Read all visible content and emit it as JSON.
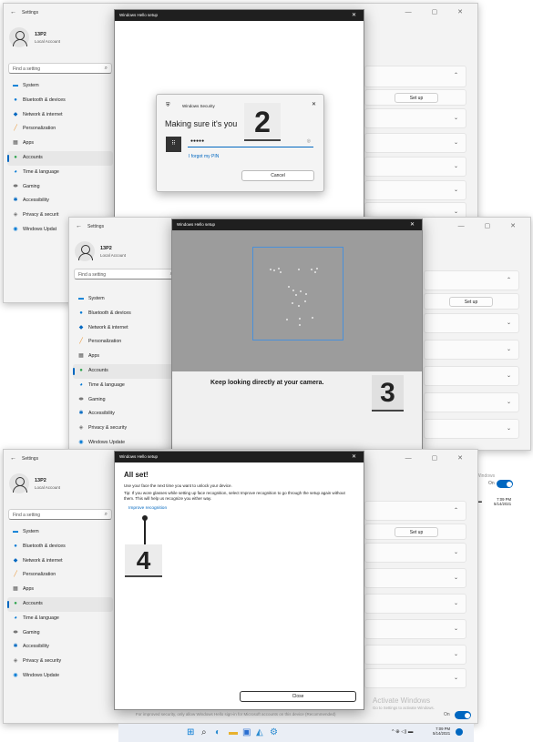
{
  "settings": {
    "title": "Settings",
    "back_icon": "back-arrow-icon",
    "controls": "—  ▢  ✕",
    "user": {
      "name": "13P2",
      "type": "Local Account"
    },
    "search_placeholder": "Find a setting",
    "nav": [
      {
        "label": "System",
        "icon": "system-icon",
        "color": "#0078d4"
      },
      {
        "label": "Bluetooth & devices",
        "icon": "bluetooth-icon",
        "color": "#0078d4"
      },
      {
        "label": "Network & internet",
        "icon": "network-icon",
        "color": "#0067c0"
      },
      {
        "label": "Personalization",
        "icon": "brush-icon",
        "color": "#e8912d"
      },
      {
        "label": "Apps",
        "icon": "apps-icon",
        "color": "#555555"
      },
      {
        "label": "Accounts",
        "icon": "accounts-icon",
        "color": "#2aa34a"
      },
      {
        "label": "Time & language",
        "icon": "time-language-icon",
        "color": "#0078d4"
      },
      {
        "label": "Gaming",
        "icon": "gaming-icon",
        "color": "#777777"
      },
      {
        "label": "Accessibility",
        "icon": "accessibility-icon",
        "color": "#0067c0"
      },
      {
        "label": "Privacy & security",
        "icon": "shield-icon",
        "color": "#777777"
      },
      {
        "label": "Windows Update",
        "icon": "update-icon",
        "color": "#0078d4"
      }
    ],
    "privacy_cut": "Privacy & securit",
    "update_cut": "Windows Updat",
    "setup_button": "Set up"
  },
  "step2": {
    "window_title": "Windows Hello setup",
    "security_title": "Windows Security",
    "heading": "Making sure it's you",
    "pin_value": "●●●●●",
    "forgot_pin": "I forgot my PIN",
    "cancel": "Cancel",
    "badge": "2"
  },
  "step3": {
    "window_title": "Windows Hello setup",
    "instruction": "Keep looking directly at your camera.",
    "badge": "3"
  },
  "step4": {
    "window_title": "Windows Hello setup",
    "heading": "All set!",
    "line1": "Use your face the next time you want to unlock your device.",
    "tip": "Tip: If you wore glasses while setting up face recognition, select Improve recognition to go through the setup again without them. This will help us recognize you either way.",
    "improve": "Improve recognition",
    "close": "Close",
    "badge": "4",
    "activate_title": "Activate Windows",
    "activate_sub": "Go to Settings to activate Windows.",
    "bottom_note": "For improved security, only allow Windows Hello sign-in for Microsoft accounts on this device (Recommended)",
    "toggle_label": "On"
  },
  "taskbar": {
    "time": "7:09 PM",
    "date": "5/14/2021",
    "time_mid": "7:09 PM",
    "date_mid": "5/14/2021",
    "icons": [
      "windows-icon",
      "search-icon",
      "edge-icon",
      "explorer-icon",
      "store-icon",
      "photos-icon",
      "settings-icon"
    ],
    "tray": "^  ⊕ ◁) ▬",
    "activate_mid": "ows",
    "activate_mid2": "vate Windows",
    "toggle_mid": "On"
  }
}
